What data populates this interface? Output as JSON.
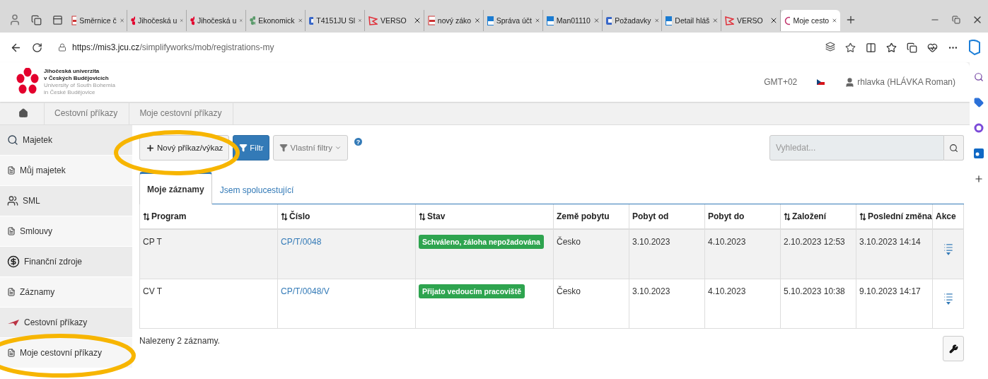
{
  "browser": {
    "tabs": [
      {
        "title": "Směrnice č",
        "kind": "pdf",
        "selected": false
      },
      {
        "title": "Jihočeská u",
        "kind": "flower",
        "selected": false
      },
      {
        "title": "Jihočeská u",
        "kind": "flower",
        "selected": false
      },
      {
        "title": "Ekonomick",
        "kind": "greenflower",
        "selected": false
      },
      {
        "title": "T4151JU Sl",
        "kind": "azure",
        "selected": false
      },
      {
        "title": "VERSO",
        "kind": "verso",
        "selected": false
      },
      {
        "title": "nový záko",
        "kind": "pdf",
        "selected": false
      },
      {
        "title": "Správa účt",
        "kind": "bbm",
        "selected": false
      },
      {
        "title": "Man01110",
        "kind": "bbm",
        "selected": false
      },
      {
        "title": "Požadavky",
        "kind": "azure",
        "selected": false
      },
      {
        "title": "Detail hláš",
        "kind": "bbm",
        "selected": false
      },
      {
        "title": "VERSO",
        "kind": "verso",
        "selected": false
      },
      {
        "title": "Moje cesto",
        "kind": "ring",
        "selected": true
      }
    ],
    "url_host": "https://mis3.jcu.cz",
    "url_path": "/simplifyworks/mob/registrations-my"
  },
  "header": {
    "logo_lines": [
      "Jihočeská univerzita",
      "v Českých Budějovicích",
      "University of South Bohemia",
      "in České Budějovice"
    ],
    "timezone": "GMT+02",
    "user": "rhlavka (HLÁVKA Roman)"
  },
  "breadcrumb": [
    "Cestovní příkazy",
    "Moje cestovní příkazy"
  ],
  "sidebar": {
    "items": [
      {
        "label": "Majetek",
        "kind": "section"
      },
      {
        "label": "Můj majetek",
        "kind": "link"
      },
      {
        "label": "SML",
        "kind": "section"
      },
      {
        "label": "Smlouvy",
        "kind": "link"
      },
      {
        "label": "Finanční zdroje",
        "kind": "section"
      },
      {
        "label": "Záznamy",
        "kind": "link"
      },
      {
        "label": "Cestovní příkazy",
        "kind": "section"
      },
      {
        "label": "Moje cestovní příkazy",
        "kind": "link"
      }
    ]
  },
  "toolbar": {
    "new_button": "Nový příkaz/výkaz",
    "filter_button": "Filtr",
    "custom_filters": "Vlastní filtry",
    "help": "?",
    "search": {
      "placeholder": "Vyhledat..."
    }
  },
  "tabs": [
    {
      "label": "Moje záznamy",
      "selected": true
    },
    {
      "label": "Jsem spolucestující",
      "selected": false
    }
  ],
  "table": {
    "columns": [
      {
        "label": "Program",
        "sortable": true
      },
      {
        "label": "Číslo",
        "sortable": true
      },
      {
        "label": "Stav",
        "sortable": true
      },
      {
        "label": "Země pobytu",
        "sortable": false
      },
      {
        "label": "Pobyt od",
        "sortable": false
      },
      {
        "label": "Pobyt do",
        "sortable": false
      },
      {
        "label": "Založení",
        "sortable": true
      },
      {
        "label": "Poslední změna",
        "sortable": true
      },
      {
        "label": "Akce",
        "sortable": false
      }
    ],
    "rows": [
      {
        "program": "CP T",
        "number": "CP/T/0048",
        "status": "Schváleno, záloha nepožadována",
        "country": "Česko",
        "from": "3.10.2023",
        "to": "4.10.2023",
        "created": "2.10.2023 12:53",
        "changed": "3.10.2023 14:14",
        "highlighted": true
      },
      {
        "program": "CV T",
        "number": "CP/T/0048/V",
        "status": "Přijato vedoucím pracoviště",
        "country": "Česko",
        "from": "3.10.2023",
        "to": "4.10.2023",
        "created": "5.10.2023 10:38",
        "changed": "9.10.2023 14:17",
        "highlighted": false
      }
    ]
  },
  "footer": "Nalezeny 2 záznamy."
}
